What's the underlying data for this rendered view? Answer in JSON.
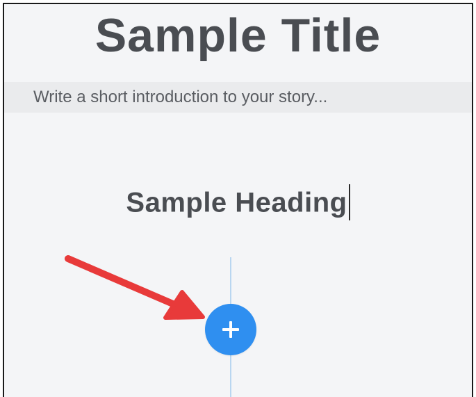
{
  "editor": {
    "title": "Sample Title",
    "intro_placeholder": "Write a short introduction to your story...",
    "heading": "Sample Heading"
  },
  "add_block": {
    "icon": "plus-icon",
    "color": "#2f8ff0"
  },
  "annotation": {
    "icon": "arrow-icon",
    "color": "#e83a3a"
  }
}
